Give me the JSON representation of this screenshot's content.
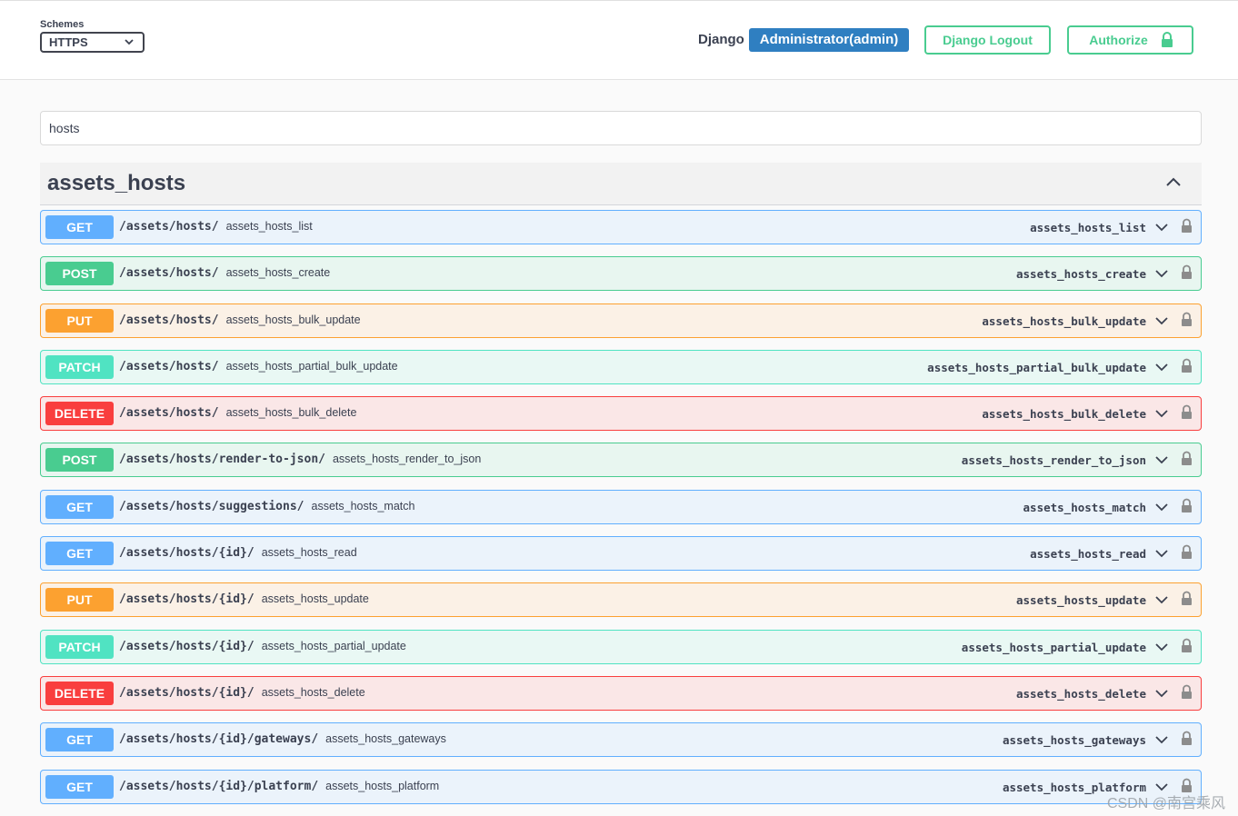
{
  "topbar": {
    "schemes_label": "Schemes",
    "schemes_value": "HTTPS",
    "django_label": "Django",
    "admin_badge": "Administrator(admin)",
    "logout_label": "Django Logout",
    "authorize_label": "Authorize"
  },
  "filter": {
    "value": "hosts"
  },
  "tag": {
    "title": "assets_hosts"
  },
  "operations": [
    {
      "method": "GET",
      "path": "/assets/hosts/",
      "summary": "assets_hosts_list",
      "operation_id": "assets_hosts_list"
    },
    {
      "method": "POST",
      "path": "/assets/hosts/",
      "summary": "assets_hosts_create",
      "operation_id": "assets_hosts_create"
    },
    {
      "method": "PUT",
      "path": "/assets/hosts/",
      "summary": "assets_hosts_bulk_update",
      "operation_id": "assets_hosts_bulk_update"
    },
    {
      "method": "PATCH",
      "path": "/assets/hosts/",
      "summary": "assets_hosts_partial_bulk_update",
      "operation_id": "assets_hosts_partial_bulk_update"
    },
    {
      "method": "DELETE",
      "path": "/assets/hosts/",
      "summary": "assets_hosts_bulk_delete",
      "operation_id": "assets_hosts_bulk_delete"
    },
    {
      "method": "POST",
      "path": "/assets/hosts/render-to-json/",
      "summary": "assets_hosts_render_to_json",
      "operation_id": "assets_hosts_render_to_json"
    },
    {
      "method": "GET",
      "path": "/assets/hosts/suggestions/",
      "summary": "assets_hosts_match",
      "operation_id": "assets_hosts_match"
    },
    {
      "method": "GET",
      "path": "/assets/hosts/{id}/",
      "summary": "assets_hosts_read",
      "operation_id": "assets_hosts_read"
    },
    {
      "method": "PUT",
      "path": "/assets/hosts/{id}/",
      "summary": "assets_hosts_update",
      "operation_id": "assets_hosts_update"
    },
    {
      "method": "PATCH",
      "path": "/assets/hosts/{id}/",
      "summary": "assets_hosts_partial_update",
      "operation_id": "assets_hosts_partial_update"
    },
    {
      "method": "DELETE",
      "path": "/assets/hosts/{id}/",
      "summary": "assets_hosts_delete",
      "operation_id": "assets_hosts_delete"
    },
    {
      "method": "GET",
      "path": "/assets/hosts/{id}/gateways/",
      "summary": "assets_hosts_gateways",
      "operation_id": "assets_hosts_gateways"
    },
    {
      "method": "GET",
      "path": "/assets/hosts/{id}/platform/",
      "summary": "assets_hosts_platform",
      "operation_id": "assets_hosts_platform"
    }
  ],
  "watermark": "CSDN @南宫乘风",
  "colors": {
    "get": "#61affe",
    "post": "#49cc90",
    "put": "#fca130",
    "patch": "#50e3c2",
    "delete": "#f93e3e",
    "admin_badge": "#2f7fc1",
    "authorize": "#49cc90"
  },
  "icons": {
    "schemes_select": "chevron-down-icon",
    "authorize": "lock-icon",
    "tag_toggle": "chevron-up-icon",
    "operation_expand": "chevron-down-icon",
    "operation_auth": "lock-icon"
  }
}
